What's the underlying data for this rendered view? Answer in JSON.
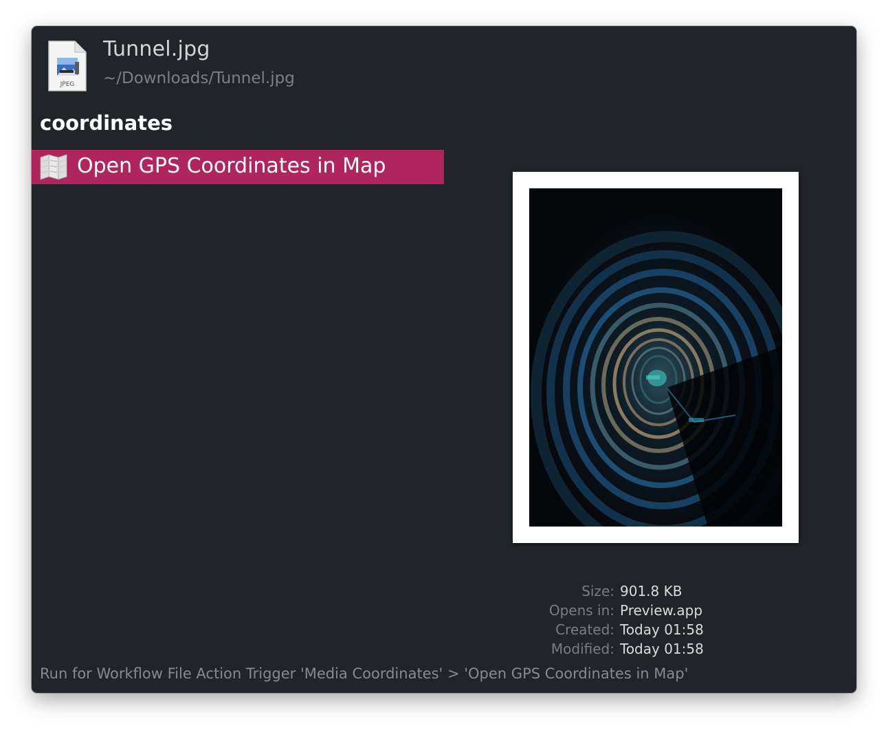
{
  "file": {
    "title": "Tunnel.jpg",
    "path": "~/Downloads/Tunnel.jpg",
    "icon_badge": "JPEG",
    "icon": "jpeg-file-icon"
  },
  "query": "coordinates",
  "results": [
    {
      "label": "Open GPS Coordinates in Map",
      "icon": "map-icon",
      "selected": true
    }
  ],
  "preview": {
    "icon": "tunnel-photo-preview"
  },
  "meta": {
    "size_label": "Size:",
    "size_value": "901.8 KB",
    "opens_label": "Opens in:",
    "opens_value": "Preview.app",
    "created_label": "Created:",
    "created_value": "Today 01:58",
    "modified_label": "Modified:",
    "modified_value": "Today 01:58"
  },
  "footer": "Run for Workflow File Action Trigger 'Media Coordinates' > 'Open GPS Coordinates in Map'",
  "colors": {
    "window_bg": "#212428",
    "selection": "#b0255e",
    "text_primary": "#ffffff",
    "text_secondary": "#7d7f83"
  }
}
